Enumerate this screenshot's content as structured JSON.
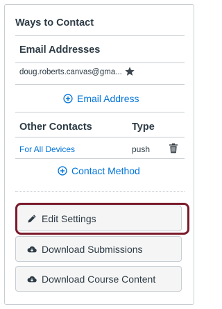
{
  "section": {
    "title": "Ways to Contact"
  },
  "email": {
    "heading": "Email Addresses",
    "address": "doug.roberts.canvas@gma...",
    "add_label": "Email Address"
  },
  "contacts": {
    "col_name": "Other Contacts",
    "col_type": "Type",
    "rows": [
      {
        "name": "For All Devices",
        "type": "push"
      }
    ],
    "add_label": "Contact Method"
  },
  "buttons": {
    "edit": "Edit Settings",
    "download_submissions": "Download Submissions",
    "download_course": "Download Course Content"
  },
  "colors": {
    "link": "#0074d9",
    "highlight": "#7a1a2b"
  },
  "icons": [
    "star-icon",
    "plus-circle-icon",
    "trash-icon",
    "pencil-icon",
    "cloud-download-icon"
  ]
}
